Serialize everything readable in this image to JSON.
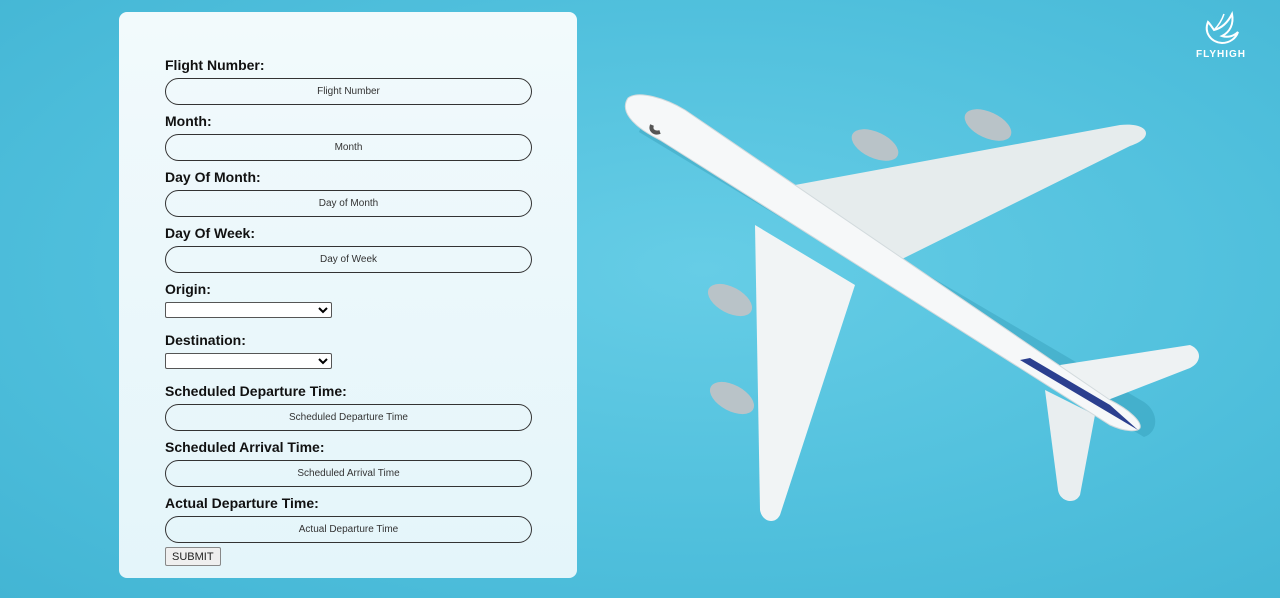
{
  "brand": {
    "name": "FLYHIGH"
  },
  "form": {
    "flight_number": {
      "label": "Flight Number:",
      "placeholder": "Flight Number"
    },
    "month": {
      "label": "Month:",
      "placeholder": "Month"
    },
    "day_of_month": {
      "label": "Day Of Month:",
      "placeholder": "Day of Month"
    },
    "day_of_week": {
      "label": "Day Of Week:",
      "placeholder": "Day of Week"
    },
    "origin": {
      "label": "Origin:",
      "value": ""
    },
    "destination": {
      "label": "Destination:",
      "value": ""
    },
    "scheduled_departure": {
      "label": "Scheduled Departure Time:",
      "placeholder": "Scheduled Departure Time"
    },
    "scheduled_arrival": {
      "label": "Scheduled Arrival Time:",
      "placeholder": "Scheduled Arrival Time"
    },
    "actual_departure": {
      "label": "Actual Departure Time:",
      "placeholder": "Actual Departure Time"
    },
    "submit_label": "SUBMIT"
  },
  "colors": {
    "background": "#4fbfdc",
    "panel": "#eaf7fb"
  },
  "icons": {
    "logo": "bird-logo-icon",
    "hero": "airplane-image"
  }
}
